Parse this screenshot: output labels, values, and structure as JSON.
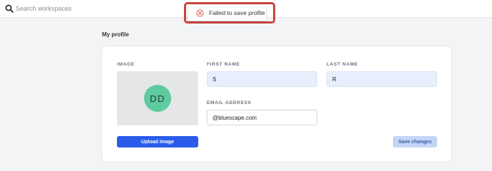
{
  "header": {
    "search": {
      "placeholder": "Search workspaces",
      "value": ""
    }
  },
  "toast": {
    "message": "Failed to save profile",
    "icon": "error-circle-icon",
    "color": "#d9534f"
  },
  "profile": {
    "section_title": "My profile",
    "image_label": "IMAGE",
    "avatar_initials": "DD",
    "first_name": {
      "label": "FIRST NAME",
      "value": "S"
    },
    "last_name": {
      "label": "LAST NAME",
      "value": "R"
    },
    "email": {
      "label": "EMAIL ADDRESS",
      "value": "@bluescape.com"
    },
    "upload_label": "Upload image",
    "save_label": "Save changes"
  },
  "colors": {
    "primary": "#2a5bea",
    "avatar_bg": "#5fc9a0",
    "save_disabled_bg": "#c5d5f7",
    "error_outline": "#c8453b"
  }
}
